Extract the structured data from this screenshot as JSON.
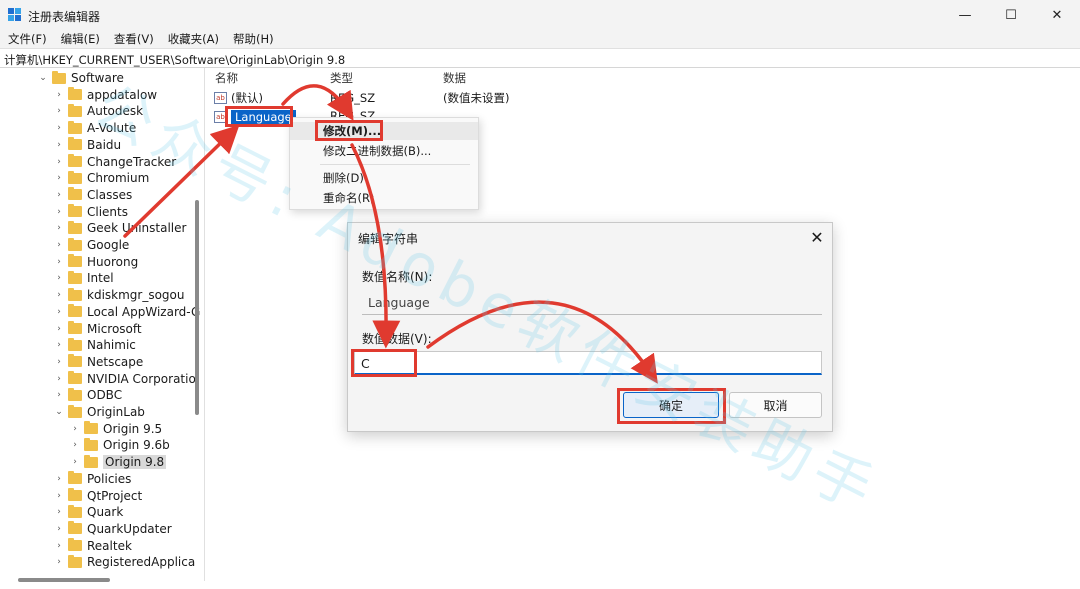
{
  "window": {
    "title": "注册表编辑器",
    "minimize_glyph": "—",
    "maximize_glyph": "☐",
    "close_glyph": "✕"
  },
  "menu": [
    "文件(F)",
    "编辑(E)",
    "查看(V)",
    "收藏夹(A)",
    "帮助(H)"
  ],
  "address": "计算机\\HKEY_CURRENT_USER\\Software\\OriginLab\\Origin 9.8",
  "tree": {
    "software": "Software",
    "children": [
      "appdatalow",
      "Autodesk",
      "A-Volute",
      "Baidu",
      "ChangeTracker",
      "Chromium",
      "Classes",
      "Clients",
      "Geek Uninstaller",
      "Google",
      "Huorong",
      "Intel",
      "kdiskmgr_sogou",
      "Local AppWizard-G",
      "Microsoft",
      "Nahimic",
      "Netscape",
      "NVIDIA Corporatio",
      "ODBC"
    ],
    "originlab": "OriginLab",
    "origin_children": [
      "Origin 9.5",
      "Origin 9.6b",
      "Origin 9.8"
    ],
    "after": [
      "Policies",
      "QtProject",
      "Quark",
      "QuarkUpdater",
      "Realtek",
      "RegisteredApplica"
    ]
  },
  "list": {
    "headers": {
      "name": "名称",
      "type": "类型",
      "data": "数据"
    },
    "rows": [
      {
        "name": "(默认)",
        "type": "REG_SZ",
        "data": "(数值未设置)",
        "icon": "ab"
      },
      {
        "name": "Language",
        "type": "REG_SZ",
        "data": "",
        "icon": "ab"
      }
    ]
  },
  "context_menu": {
    "modify": "修改(M)...",
    "modify_binary": "修改二进制数据(B)...",
    "delete": "删除(D)",
    "rename": "重命名(R)"
  },
  "dialog": {
    "title": "编辑字符串",
    "name_label": "数值名称(N):",
    "name_value": "Language",
    "data_label": "数值数据(V):",
    "data_value": "C",
    "ok": "确定",
    "cancel": "取消",
    "close_glyph": "✕"
  },
  "watermark": "公众号: Adobe软件安装助手",
  "colors": {
    "selection": "#0a64c8",
    "annotation": "#e03a2f",
    "folder": "#f0c04a"
  }
}
